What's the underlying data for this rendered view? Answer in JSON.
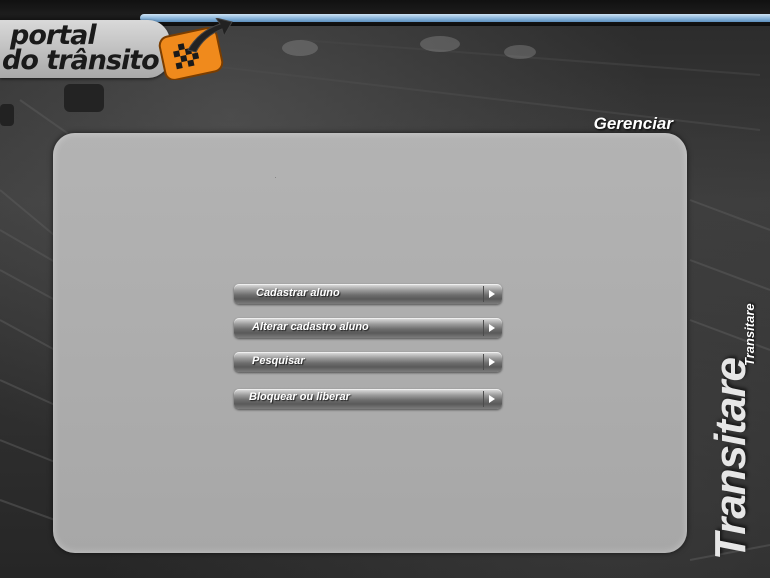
{
  "header": {
    "logo": {
      "line1": "portal",
      "line2": "do trânsito",
      "brand_orange": "#f08a1c",
      "stripe_blue": "#8fb9dd"
    },
    "section_title": "Gerenciar"
  },
  "menu": {
    "items": [
      {
        "label": "Cadastrar aluno",
        "icon": "play-arrow-icon"
      },
      {
        "label": "Alterar cadastro aluno",
        "icon": "play-arrow-icon"
      },
      {
        "label": "Pesquisar",
        "icon": "play-arrow-icon"
      },
      {
        "label": "Bloquear ou liberar",
        "icon": "play-arrow-icon"
      }
    ]
  },
  "brand": {
    "vertical_large": "Transitare",
    "vertical_small": "Transitare"
  },
  "colors": {
    "panel": "#ababab",
    "button_text": "#ffffff",
    "background": "#2f2f2f"
  }
}
